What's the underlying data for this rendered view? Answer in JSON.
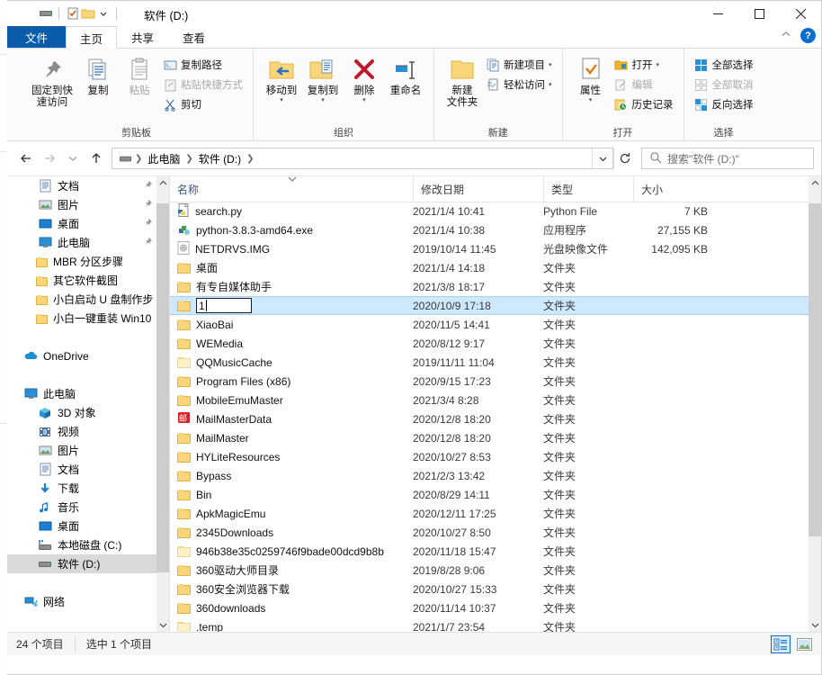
{
  "window": {
    "title": "软件 (D:)",
    "quick_access": [
      "drive-icon",
      "properties-icon",
      "new-folder-icon",
      "qat-dropdown-icon"
    ],
    "minimize": "—",
    "maximize": "▢",
    "close": "✕"
  },
  "tabs": [
    {
      "label": "文件",
      "name": "tab-file",
      "style": "file"
    },
    {
      "label": "主页",
      "name": "tab-home",
      "style": "active"
    },
    {
      "label": "共享",
      "name": "tab-share",
      "style": "normal"
    },
    {
      "label": "查看",
      "name": "tab-view",
      "style": "normal"
    }
  ],
  "ribbon": {
    "collapse_icon": "chevron-up-icon",
    "help_icon": "?",
    "groups": [
      {
        "label": "剪贴板",
        "big": [
          {
            "label": "固定到快\n速访问",
            "icon": "pin-icon",
            "dim": false
          },
          {
            "label": "复制",
            "icon": "copy-icon",
            "dim": false
          },
          {
            "label": "粘贴",
            "icon": "paste-icon",
            "dim": true
          }
        ],
        "small": [
          {
            "label": "复制路径",
            "icon": "copy-path-icon",
            "dim": false
          },
          {
            "label": "粘贴快捷方式",
            "icon": "paste-shortcut-icon",
            "dim": true
          },
          {
            "label": "剪切",
            "icon": "scissors-icon",
            "dim": false
          }
        ]
      },
      {
        "label": "组织",
        "big": [
          {
            "label": "移动到",
            "icon": "move-to-icon",
            "dropdown": true
          },
          {
            "label": "复制到",
            "icon": "copy-to-icon",
            "dropdown": true
          },
          {
            "label": "删除",
            "icon": "delete-icon",
            "dropdown": true
          },
          {
            "label": "重命名",
            "icon": "rename-icon",
            "dropdown": false
          }
        ]
      },
      {
        "label": "新建",
        "big": [
          {
            "label": "新建\n文件夹",
            "icon": "new-folder-icon"
          }
        ],
        "small": [
          {
            "label": "新建项目",
            "icon": "new-item-icon",
            "dropdown": true
          },
          {
            "label": "轻松访问",
            "icon": "easy-access-icon",
            "dropdown": true
          }
        ]
      },
      {
        "label": "打开",
        "big": [
          {
            "label": "属性",
            "icon": "properties-icon",
            "dropdown": true
          }
        ],
        "small": [
          {
            "label": "打开",
            "icon": "open-icon",
            "dropdown": true,
            "dim": false
          },
          {
            "label": "编辑",
            "icon": "edit-icon",
            "dim": true
          },
          {
            "label": "历史记录",
            "icon": "history-icon",
            "dim": false
          }
        ]
      },
      {
        "label": "选择",
        "small": [
          {
            "label": "全部选择",
            "icon": "select-all-icon",
            "dim": false
          },
          {
            "label": "全部取消",
            "icon": "select-none-icon",
            "dim": true
          },
          {
            "label": "反向选择",
            "icon": "invert-selection-icon",
            "dim": false
          }
        ]
      }
    ]
  },
  "address": {
    "back_icon": "arrow-left-icon",
    "forward_icon": "arrow-right-icon",
    "recent_icon": "chevron-down-icon",
    "up_icon": "arrow-up-icon",
    "crumbs": [
      "此电脑",
      "软件 (D:)"
    ],
    "dropdown_icon": "chevron-down-icon",
    "refresh_icon": "refresh-icon",
    "search_placeholder": "搜索\"软件 (D:)\""
  },
  "nav": {
    "items": [
      {
        "label": "文档",
        "icon": "documents-icon",
        "indent": 1,
        "pinned": true
      },
      {
        "label": "图片",
        "icon": "pictures-icon",
        "indent": 1,
        "pinned": true
      },
      {
        "label": "桌面",
        "icon": "desktop-icon",
        "indent": 1,
        "pinned": true
      },
      {
        "label": "此电脑",
        "icon": "this-pc-icon",
        "indent": 1,
        "pinned": true
      },
      {
        "label": "MBR 分区步骤",
        "icon": "folder-icon",
        "indent": 1,
        "pinned": false
      },
      {
        "label": "其它软件截图",
        "icon": "folder-icon",
        "indent": 1,
        "pinned": false
      },
      {
        "label": "小白启动 U 盘制作步",
        "icon": "folder-icon",
        "indent": 1,
        "pinned": false
      },
      {
        "label": "小白一键重装 Win10",
        "icon": "folder-icon",
        "indent": 1,
        "pinned": false
      },
      {
        "label": "",
        "icon": "spacer",
        "indent": 0,
        "pinned": false
      },
      {
        "label": "OneDrive",
        "icon": "onedrive-icon",
        "indent": 0,
        "pinned": false
      },
      {
        "label": "",
        "icon": "spacer",
        "indent": 0,
        "pinned": false
      },
      {
        "label": "此电脑",
        "icon": "this-pc-icon",
        "indent": 0,
        "pinned": false
      },
      {
        "label": "3D 对象",
        "icon": "3d-objects-icon",
        "indent": 1,
        "pinned": false
      },
      {
        "label": "视频",
        "icon": "videos-icon",
        "indent": 1,
        "pinned": false
      },
      {
        "label": "图片",
        "icon": "pictures-icon",
        "indent": 1,
        "pinned": false
      },
      {
        "label": "文档",
        "icon": "documents-icon",
        "indent": 1,
        "pinned": false
      },
      {
        "label": "下载",
        "icon": "downloads-icon",
        "indent": 1,
        "pinned": false
      },
      {
        "label": "音乐",
        "icon": "music-icon",
        "indent": 1,
        "pinned": false
      },
      {
        "label": "桌面",
        "icon": "desktop-icon",
        "indent": 1,
        "pinned": false
      },
      {
        "label": "本地磁盘 (C:)",
        "icon": "drive-c-icon",
        "indent": 1,
        "pinned": false
      },
      {
        "label": "软件 (D:)",
        "icon": "drive-icon",
        "indent": 1,
        "pinned": false,
        "selected": true
      },
      {
        "label": "",
        "icon": "spacer",
        "indent": 0,
        "pinned": false
      },
      {
        "label": "网络",
        "icon": "network-icon",
        "indent": 0,
        "pinned": false
      }
    ]
  },
  "filelist": {
    "columns": [
      {
        "label": "名称",
        "name": "column-name"
      },
      {
        "label": "修改日期",
        "name": "column-date"
      },
      {
        "label": "类型",
        "name": "column-type"
      },
      {
        "label": "大小",
        "name": "column-size"
      }
    ],
    "sort_indicator": "⌄",
    "rows": [
      {
        "name": "search.py",
        "date": "2021/1/4 10:41",
        "type": "Python File",
        "size": "7 KB",
        "icon": "python-file-icon"
      },
      {
        "name": "python-3.8.3-amd64.exe",
        "date": "2021/1/4 10:38",
        "type": "应用程序",
        "size": "27,155 KB",
        "icon": "exe-file-icon"
      },
      {
        "name": "NETDRVS.IMG",
        "date": "2019/10/14 11:45",
        "type": "光盘映像文件",
        "size": "142,095 KB",
        "icon": "disc-image-icon"
      },
      {
        "name": "桌面",
        "date": "2021/1/4 14:18",
        "type": "文件夹",
        "size": "",
        "icon": "folder-icon"
      },
      {
        "name": "有专自媒体助手",
        "date": "2021/3/8 18:17",
        "type": "文件夹",
        "size": "",
        "icon": "folder-icon"
      },
      {
        "name": "1",
        "date": "2020/10/9 17:18",
        "type": "文件夹",
        "size": "",
        "icon": "folder-icon",
        "selected": true,
        "renaming": true
      },
      {
        "name": "XiaoBai",
        "date": "2020/11/5 14:41",
        "type": "文件夹",
        "size": "",
        "icon": "folder-icon"
      },
      {
        "name": "WEMedia",
        "date": "2020/8/12 9:17",
        "type": "文件夹",
        "size": "",
        "icon": "folder-icon"
      },
      {
        "name": "QQMusicCache",
        "date": "2019/11/11 11:04",
        "type": "文件夹",
        "size": "",
        "icon": "folder-pale-icon"
      },
      {
        "name": "Program Files (x86)",
        "date": "2020/9/15 17:23",
        "type": "文件夹",
        "size": "",
        "icon": "folder-icon"
      },
      {
        "name": "MobileEmuMaster",
        "date": "2021/3/4 8:28",
        "type": "文件夹",
        "size": "",
        "icon": "folder-icon"
      },
      {
        "name": "MailMasterData",
        "date": "2020/12/8 18:20",
        "type": "文件夹",
        "size": "",
        "icon": "mail-folder-icon"
      },
      {
        "name": "MailMaster",
        "date": "2020/12/8 18:20",
        "type": "文件夹",
        "size": "",
        "icon": "folder-icon"
      },
      {
        "name": "HYLiteResources",
        "date": "2020/10/27 8:53",
        "type": "文件夹",
        "size": "",
        "icon": "folder-icon"
      },
      {
        "name": "Bypass",
        "date": "2021/2/3 13:42",
        "type": "文件夹",
        "size": "",
        "icon": "folder-icon"
      },
      {
        "name": "Bin",
        "date": "2020/8/29 14:11",
        "type": "文件夹",
        "size": "",
        "icon": "folder-icon"
      },
      {
        "name": "ApkMagicEmu",
        "date": "2020/12/11 17:25",
        "type": "文件夹",
        "size": "",
        "icon": "folder-icon"
      },
      {
        "name": "2345Downloads",
        "date": "2020/10/27 8:50",
        "type": "文件夹",
        "size": "",
        "icon": "folder-icon"
      },
      {
        "name": "946b38e35c0259746f9bade00dcd9b8b",
        "date": "2020/11/18 15:47",
        "type": "文件夹",
        "size": "",
        "icon": "folder-pale-icon"
      },
      {
        "name": "360驱动大师目录",
        "date": "2019/8/28 9:06",
        "type": "文件夹",
        "size": "",
        "icon": "folder-icon"
      },
      {
        "name": "360安全浏览器下载",
        "date": "2020/10/27 15:33",
        "type": "文件夹",
        "size": "",
        "icon": "folder-icon"
      },
      {
        "name": "360downloads",
        "date": "2020/11/14 10:37",
        "type": "文件夹",
        "size": "",
        "icon": "folder-icon"
      },
      {
        "name": ".temp",
        "date": "2021/1/7 23:54",
        "type": "文件夹",
        "size": "",
        "icon": "folder-pale-icon"
      }
    ]
  },
  "status": {
    "item_count": "24 个项目",
    "selection": "选中 1 个项目",
    "view_details": "details-view-icon",
    "view_large": "large-icons-view-icon"
  },
  "colors": {
    "accent": "#0b5cab",
    "selection": "#cde8ff",
    "folder": "#fbd579",
    "header_text": "#3b5577"
  }
}
